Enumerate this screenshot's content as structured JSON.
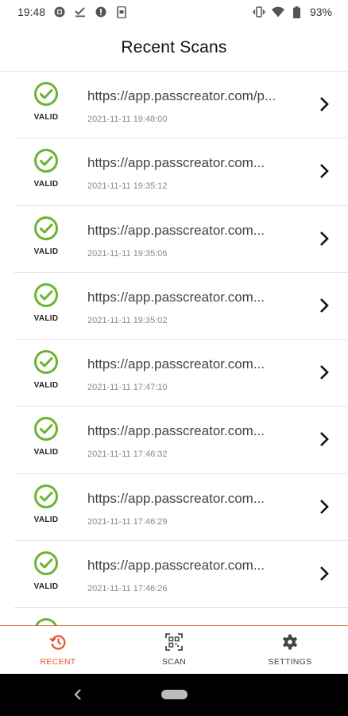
{
  "status_bar": {
    "time": "19:48",
    "battery": "93%"
  },
  "header": {
    "title": "Recent Scans"
  },
  "scans": [
    {
      "status": "VALID",
      "url": "https://app.passcreator.com/p...",
      "time": "2021-11-11 19:48:00"
    },
    {
      "status": "VALID",
      "url": "https://app.passcreator.com...",
      "time": "2021-11-11 19:35:12"
    },
    {
      "status": "VALID",
      "url": "https://app.passcreator.com...",
      "time": "2021-11-11 19:35:06"
    },
    {
      "status": "VALID",
      "url": "https://app.passcreator.com...",
      "time": "2021-11-11 19:35:02"
    },
    {
      "status": "VALID",
      "url": "https://app.passcreator.com...",
      "time": "2021-11-11 17:47:10"
    },
    {
      "status": "VALID",
      "url": "https://app.passcreator.com...",
      "time": "2021-11-11 17:46:32"
    },
    {
      "status": "VALID",
      "url": "https://app.passcreator.com...",
      "time": "2021-11-11 17:46:29"
    },
    {
      "status": "VALID",
      "url": "https://app.passcreator.com...",
      "time": "2021-11-11 17:46:26"
    }
  ],
  "bottom_nav": {
    "recent_label": "RECENT",
    "scan_label": "SCAN",
    "settings_label": "SETTINGS"
  },
  "colors": {
    "accent": "#e2552c",
    "valid_green": "#6ab42f"
  }
}
